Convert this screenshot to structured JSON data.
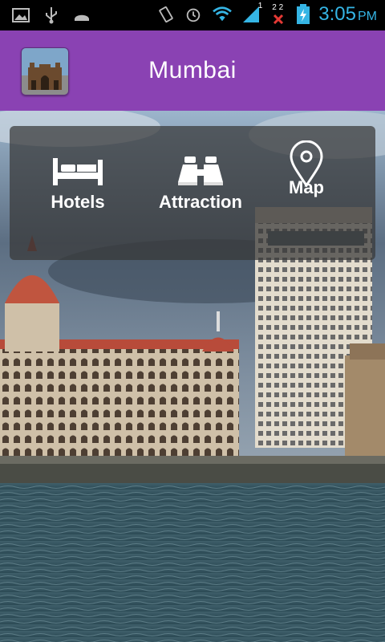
{
  "status_bar": {
    "left_icons": [
      "image-icon",
      "usb-icon",
      "android-icon"
    ],
    "right_icons": [
      "vibrate-icon",
      "alarm-icon",
      "wifi-icon",
      "signal-icon",
      "no-signal-icon",
      "battery-charging-icon"
    ],
    "signal_label": "1",
    "sim2_label": "2 2",
    "time": "3:05",
    "ampm": "PM"
  },
  "app_bar": {
    "title": "Mumbai",
    "icon": "gateway-of-india-icon",
    "color": "#8a42b3"
  },
  "menu": {
    "items": [
      {
        "label": "Hotels",
        "icon": "bed-icon"
      },
      {
        "label": "Attraction",
        "icon": "binoculars-icon"
      },
      {
        "label": "Map",
        "icon": "map-pin-icon"
      }
    ]
  }
}
